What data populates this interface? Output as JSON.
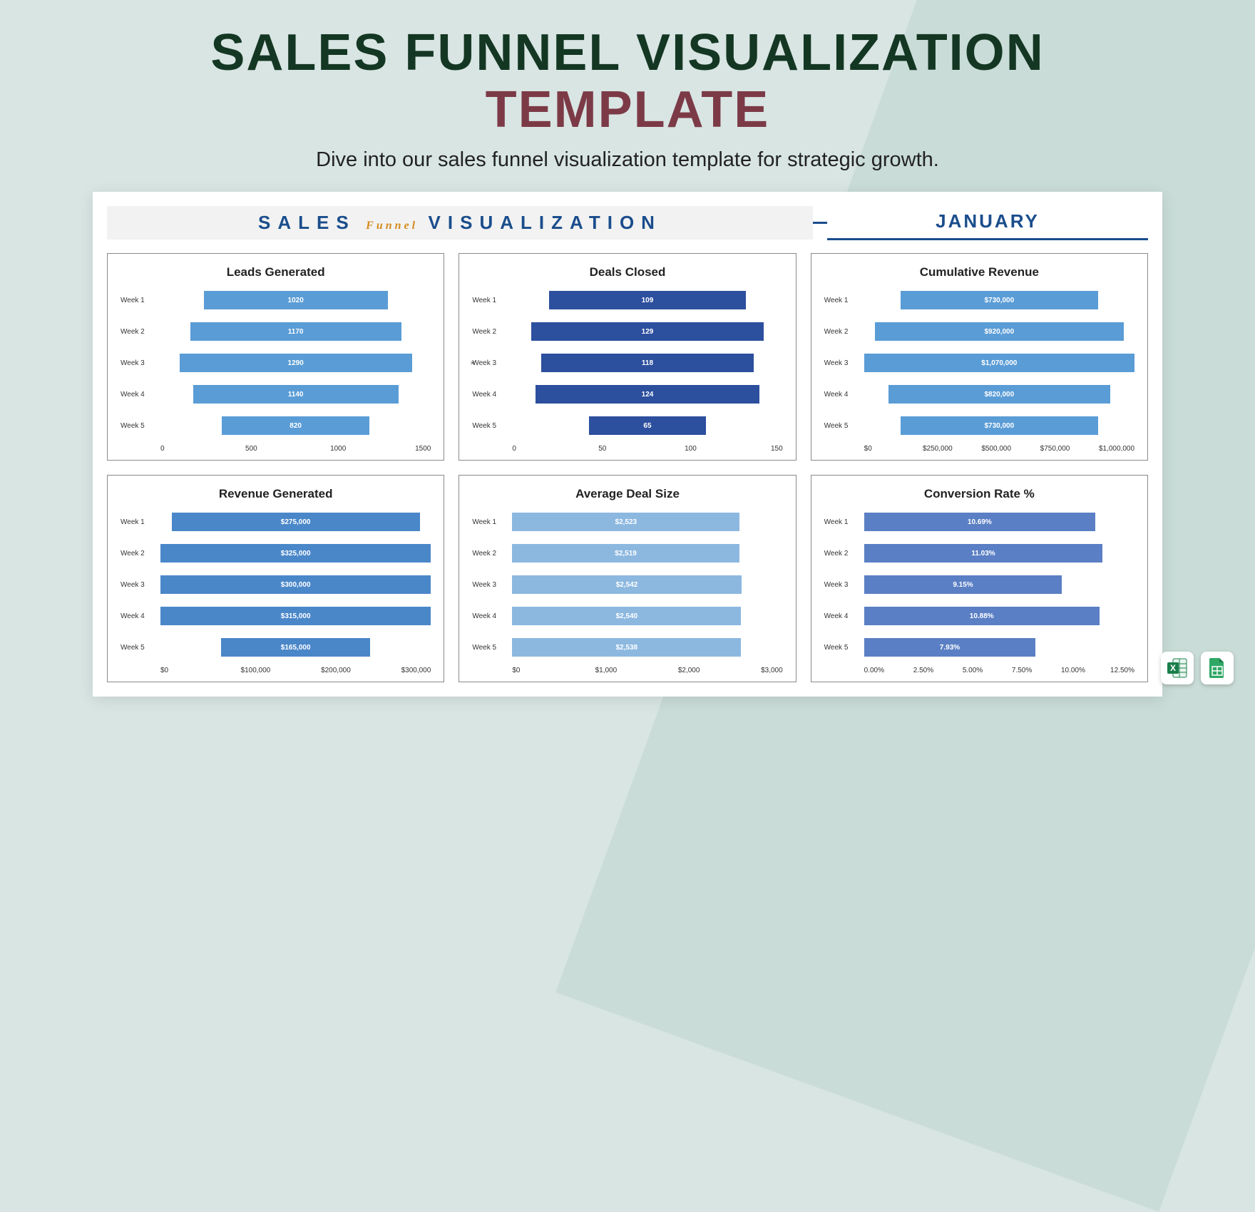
{
  "header": {
    "title_line1": "SALES FUNNEL VISUALIZATION",
    "title_line2": "TEMPLATE",
    "subtitle": "Dive into our sales funnel visualization template for strategic growth."
  },
  "dashboard": {
    "title_part1": "SALES",
    "title_accent": "Funnel",
    "title_part2": "VISUALIZATION",
    "month": "JANUARY"
  },
  "chart_data": [
    {
      "type": "bar",
      "title": "Leads Generated",
      "categories": [
        "Week 1",
        "Week 2",
        "Week 3",
        "Week 4",
        "Week 5"
      ],
      "values": [
        1020,
        1170,
        1290,
        1140,
        820
      ],
      "labels": [
        "1020",
        "1170",
        "1290",
        "1140",
        "820"
      ],
      "xlim": [
        0,
        1500
      ],
      "xticks": [
        "0",
        "500",
        "1000",
        "1500"
      ],
      "centered": true,
      "color": "#5a9cd6",
      "ylabel": ""
    },
    {
      "type": "bar",
      "title": "Deals Closed",
      "categories": [
        "Week 1",
        "Week 2",
        "Week 3",
        "Week 4",
        "Week 5"
      ],
      "values": [
        109,
        129,
        118,
        124,
        65
      ],
      "labels": [
        "109",
        "129",
        "118",
        "124",
        "65"
      ],
      "xlim": [
        0,
        150
      ],
      "xticks": [
        "0",
        "50",
        "100",
        "150"
      ],
      "centered": true,
      "color": "#2c4f9e",
      "ylabel": "x"
    },
    {
      "type": "bar",
      "title": "Cumulative Revenue",
      "categories": [
        "Week 1",
        "Week 2",
        "Week 3",
        "Week 4",
        "Week 5"
      ],
      "values": [
        730000,
        920000,
        1070000,
        820000,
        730000
      ],
      "labels": [
        "$730,000",
        "$920,000",
        "$1,070,000",
        "$820,000",
        "$730,000"
      ],
      "xlim": [
        0,
        1000000
      ],
      "xticks": [
        "$0",
        "$250,000",
        "$500,000",
        "$750,000",
        "$1,000,000"
      ],
      "centered": true,
      "color": "#5a9cd6",
      "ylabel": ""
    },
    {
      "type": "bar",
      "title": "Revenue Generated",
      "categories": [
        "Week 1",
        "Week 2",
        "Week 3",
        "Week 4",
        "Week 5"
      ],
      "values": [
        275000,
        325000,
        300000,
        315000,
        165000
      ],
      "labels": [
        "$275,000",
        "$325,000",
        "$300,000",
        "$315,000",
        "$165,000"
      ],
      "xlim": [
        0,
        300000
      ],
      "xticks": [
        "$0",
        "$100,000",
        "$200,000",
        "$300,000"
      ],
      "centered": true,
      "color": "#4a87c9",
      "ylabel": ""
    },
    {
      "type": "bar",
      "title": "Average Deal Size",
      "categories": [
        "Week 1",
        "Week 2",
        "Week 3",
        "Week 4",
        "Week 5"
      ],
      "values": [
        2523,
        2519,
        2542,
        2540,
        2538
      ],
      "labels": [
        "$2,523",
        "$2,519",
        "$2,542",
        "$2,540",
        "$2,538"
      ],
      "xlim": [
        0,
        3000
      ],
      "xticks": [
        "$0",
        "$1,000",
        "$2,000",
        "$3,000"
      ],
      "centered": false,
      "color": "#8cb8e0",
      "ylabel": ""
    },
    {
      "type": "bar",
      "title": "Conversion Rate %",
      "categories": [
        "Week 1",
        "Week 2",
        "Week 3",
        "Week 4",
        "Week 5"
      ],
      "values": [
        10.69,
        11.03,
        9.15,
        10.88,
        7.93
      ],
      "labels": [
        "10.69%",
        "11.03%",
        "9.15%",
        "10.88%",
        "7.93%"
      ],
      "xlim": [
        0,
        12.5
      ],
      "xticks": [
        "0.00%",
        "2.50%",
        "5.00%",
        "7.50%",
        "10.00%",
        "12.50%"
      ],
      "centered": false,
      "color": "#5a7fc4",
      "ylabel": ""
    }
  ],
  "icons": {
    "excel": "excel-icon",
    "sheets": "sheets-icon"
  }
}
